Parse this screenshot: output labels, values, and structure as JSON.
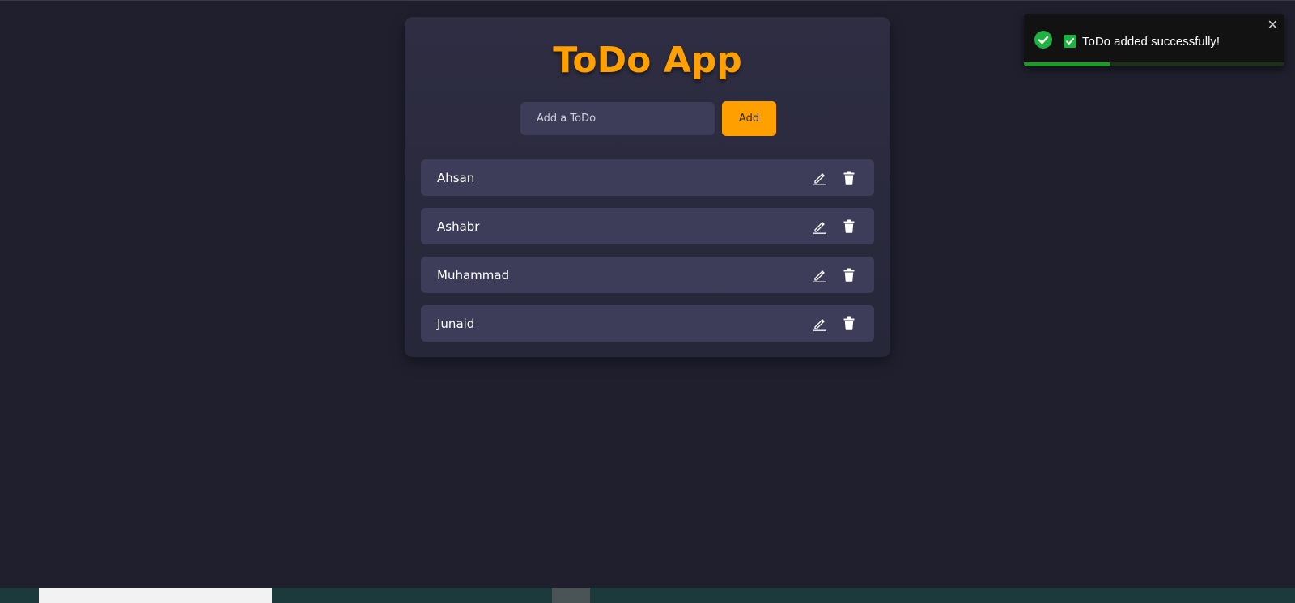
{
  "app": {
    "title": "ToDo App"
  },
  "add_form": {
    "input_placeholder": "Add a ToDo",
    "input_value": "",
    "add_label": "Add"
  },
  "todos": [
    {
      "text": "Ahsan"
    },
    {
      "text": "Ashabr"
    },
    {
      "text": "Muhammad"
    },
    {
      "text": "Junaid"
    }
  ],
  "toast": {
    "message": "ToDo added successfully!",
    "close_glyph": "✕",
    "status_icon": "check-circle-icon",
    "emoji_icon": "checkbox-check-icon",
    "progress_fraction": 0.33
  },
  "colors": {
    "accent": "#ffa000",
    "background": "#1f1f2e",
    "card": "#2b2a3e",
    "item": "#3d3d5a",
    "success": "#1fb141",
    "toast_bg": "#121212"
  }
}
